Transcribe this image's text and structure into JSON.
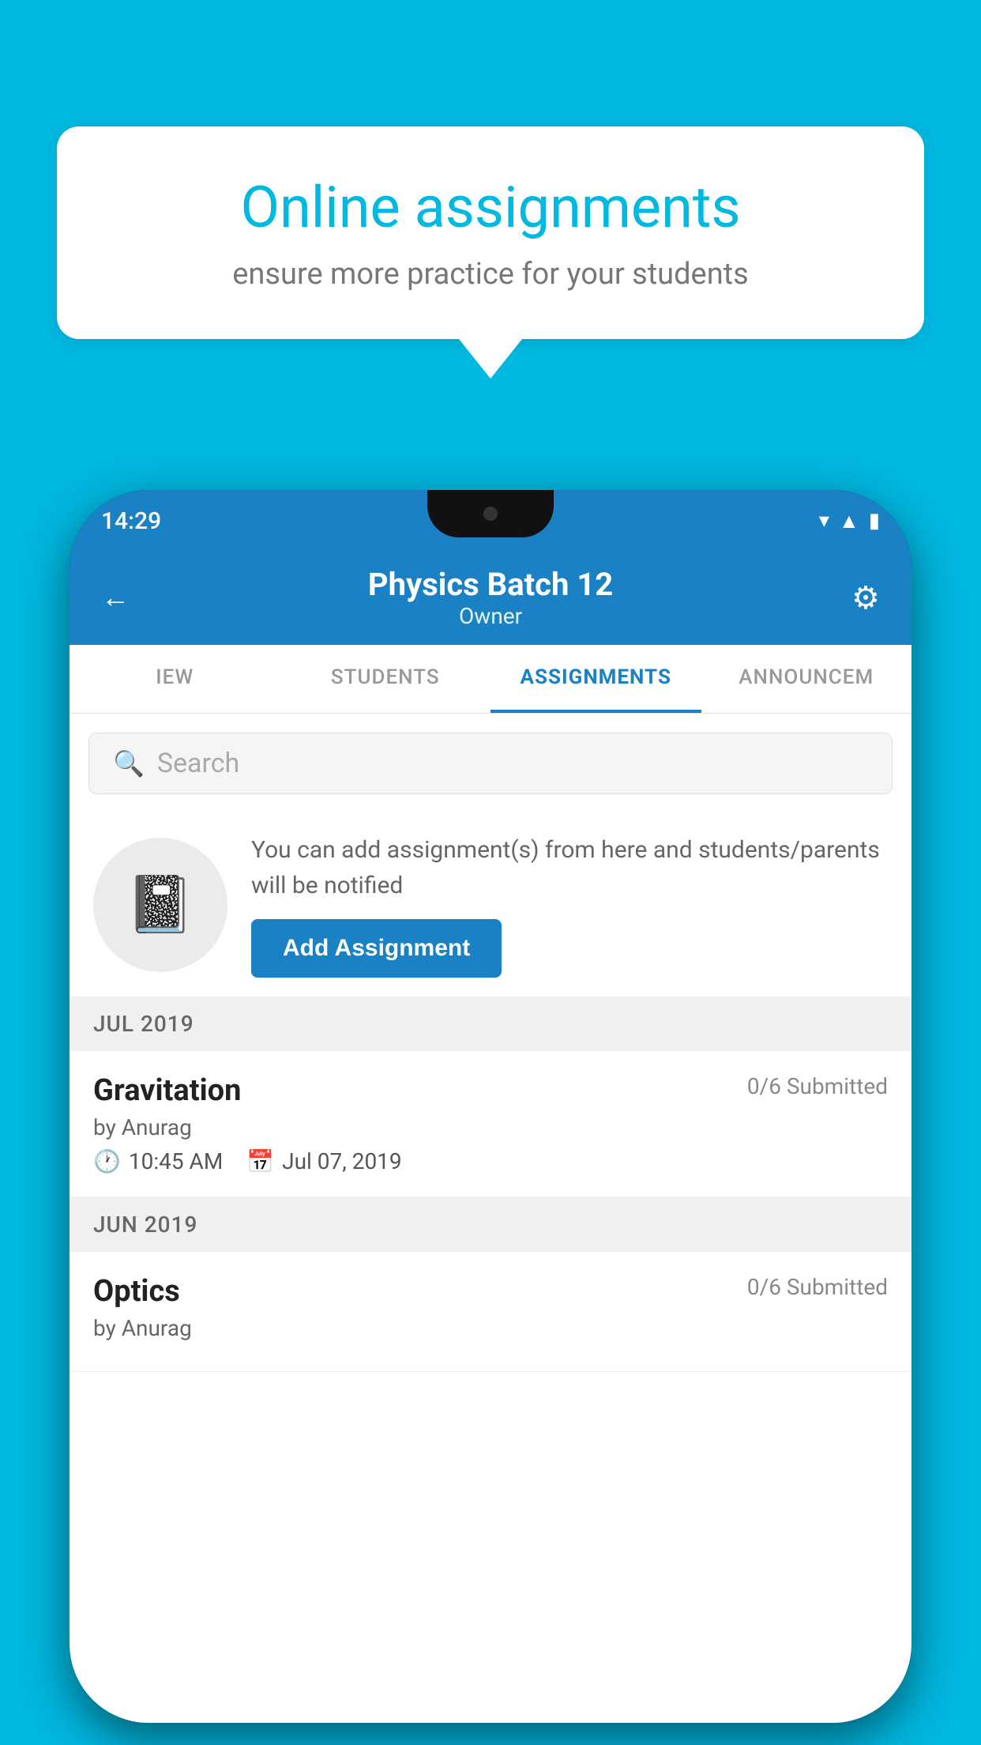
{
  "background_color": "#00b8e0",
  "bubble": {
    "title": "Online assignments",
    "subtitle": "ensure more practice for your students"
  },
  "phone": {
    "status_bar": {
      "time": "14:29"
    },
    "header": {
      "title": "Physics Batch 12",
      "subtitle": "Owner",
      "back_label": "←",
      "settings_label": "⚙"
    },
    "tabs": [
      {
        "label": "IEW",
        "active": false
      },
      {
        "label": "STUDENTS",
        "active": false
      },
      {
        "label": "ASSIGNMENTS",
        "active": true
      },
      {
        "label": "ANNOUNCEM",
        "active": false
      }
    ],
    "search": {
      "placeholder": "Search"
    },
    "info_card": {
      "text": "You can add assignment(s) from here and students/parents will be notified",
      "button_label": "Add Assignment"
    },
    "sections": [
      {
        "header": "JUL 2019",
        "assignments": [
          {
            "title": "Gravitation",
            "status": "0/6 Submitted",
            "author": "by Anurag",
            "time": "10:45 AM",
            "date": "Jul 07, 2019"
          }
        ]
      },
      {
        "header": "JUN 2019",
        "assignments": [
          {
            "title": "Optics",
            "status": "0/6 Submitted",
            "author": "by Anurag",
            "time": "",
            "date": ""
          }
        ]
      }
    ]
  }
}
